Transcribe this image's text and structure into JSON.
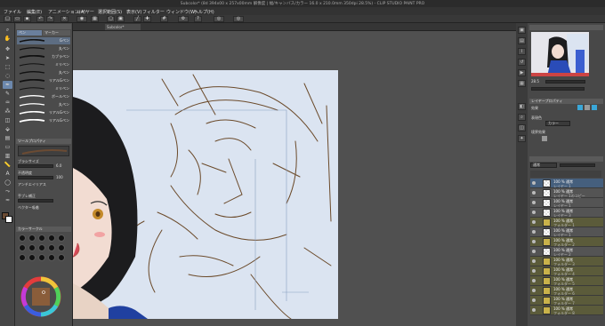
{
  "window": {
    "title": "Subcolor* (8d 394x00 x 257x00mm 解像度 | 幅/キャンバス/カラー 16.0 x 210.0mm 350dpi 28.5%) - CLIP STUDIO PAINT PRO"
  },
  "menu": [
    "ファイル",
    "編集(E)",
    "アニメーション(A)",
    "レイヤー",
    "選択範囲(S)",
    "表示(V)",
    "フィルター",
    "ウィンドウ(W)",
    "ヘルプ(H)"
  ],
  "doc_tab": "Subcolor*",
  "subtool": {
    "tab_pen": "ペン",
    "tab_marker": "マーカー",
    "brushes": [
      "Gペン",
      "丸ペン",
      "カブラペン",
      "ミリペン",
      "丸ペン",
      "リアルGペン",
      "ミリペン",
      "ボールペン",
      "丸ペン",
      "リアルGペン",
      "リアルGペン"
    ],
    "detail_header": "ツールプロパティ",
    "props": [
      "ブラシサイズ",
      "不透明度",
      "アンチエイリアス",
      "手ブレ補正",
      "ベクター吸着"
    ],
    "brush_size": "6.0",
    "opacity": "100",
    "color_header": "カラーサークル"
  },
  "navigator": {
    "zoom": "28.5"
  },
  "layer_props": {
    "header": "レイヤープロパティ",
    "effect": "効果",
    "expression": "表現色",
    "color": "カラー",
    "boundary": "境界効果"
  },
  "layers": {
    "blend": "通常",
    "rows": [
      {
        "name": "100 % 通常",
        "sub": "レイヤー 1",
        "kind": "layer"
      },
      {
        "name": "100 % 通常",
        "sub": "レイヤー 1のコピー",
        "kind": "layer"
      },
      {
        "name": "100 % 通常",
        "sub": "レイヤー 1",
        "kind": "layer"
      },
      {
        "name": "100 % 通常",
        "sub": "レイヤー 3",
        "kind": "layer"
      },
      {
        "name": "100 % 通常",
        "sub": "フォルダー 1",
        "kind": "folder"
      },
      {
        "name": "100 % 通常",
        "sub": "レイヤー 1",
        "kind": "layer"
      },
      {
        "name": "100 % 通常",
        "sub": "フォルダー 2",
        "kind": "folder"
      },
      {
        "name": "100 % 通常",
        "sub": "レイヤー 2",
        "kind": "layer"
      },
      {
        "name": "100 % 通常",
        "sub": "フォルダー 3",
        "kind": "folder"
      },
      {
        "name": "100 % 通常",
        "sub": "フォルダー 4",
        "kind": "folder"
      },
      {
        "name": "100 % 通常",
        "sub": "フォルダー 5",
        "kind": "folder"
      },
      {
        "name": "100 % 通常",
        "sub": "フォルダー 6",
        "kind": "folder"
      },
      {
        "name": "100 % 通常",
        "sub": "フォルダー 7",
        "kind": "folder"
      },
      {
        "name": "100 % 通常",
        "sub": "フォルダー 8",
        "kind": "folder"
      }
    ]
  },
  "colors": {
    "main": "#6b4b33",
    "sub": "#ffffff",
    "sketch": "#6b4a2a",
    "hair": "#1c1c1e",
    "canvas": "#dbe4f1"
  }
}
